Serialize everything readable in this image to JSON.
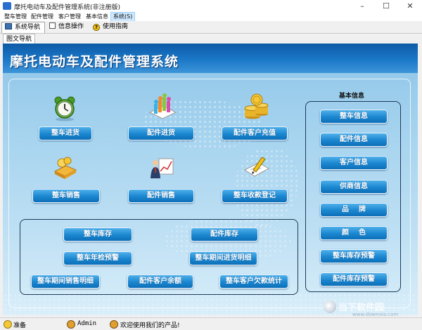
{
  "window": {
    "title": "摩托电动车及配件管理系统(非注册版)",
    "minimize_glyph": "–",
    "maximize_glyph": "☐",
    "close_glyph": "✕"
  },
  "menubar": {
    "items": [
      "整车管理",
      "配件管理",
      "客户管理",
      "基本信息",
      "系统(S)"
    ]
  },
  "tabs": {
    "items": [
      {
        "label": "系统导航",
        "icon": "monitor-icon"
      },
      {
        "label": "信息操作",
        "icon": "checkbox-icon"
      },
      {
        "label": "使用指南",
        "icon": "help-icon"
      }
    ]
  },
  "subtab": {
    "label": "图文导航"
  },
  "main": {
    "heading": "摩托电动车及配件管理系统",
    "icon_buttons": [
      {
        "label": "整车进货",
        "icon": "alarm-clock-icon"
      },
      {
        "label": "配件进货",
        "icon": "people-chart-icon"
      },
      {
        "label": "配件客户充值",
        "icon": "gold-coins-icon"
      },
      {
        "label": "整车销售",
        "icon": "coins-book-icon"
      },
      {
        "label": "配件销售",
        "icon": "businessman-chart-icon"
      },
      {
        "label": "整车收款登记",
        "icon": "pencil-document-icon"
      }
    ],
    "report_buttons": [
      "整车库存",
      "配件库存",
      "整车年检预警",
      "整车期间进货明细",
      "整车期间销售明细",
      "配件客户余额",
      "整车客户欠款统计"
    ]
  },
  "basic_info": {
    "title": "基本信息",
    "buttons": [
      "整车信息",
      "配件信息",
      "客户信息",
      "供商信息",
      "品    牌",
      "颜    色",
      "整车库存预警",
      "配件库存预警"
    ]
  },
  "statusbar": {
    "ready": "准备",
    "user": "Admin",
    "welcome": "欢迎使用我们的产品!"
  },
  "watermark": {
    "name": "当下软件园",
    "url": "www.downxia.com"
  },
  "colors": {
    "header_blue": "#1b78c8",
    "button_blue": "#1a86cf",
    "panel_bg": "#a7d4ef"
  }
}
